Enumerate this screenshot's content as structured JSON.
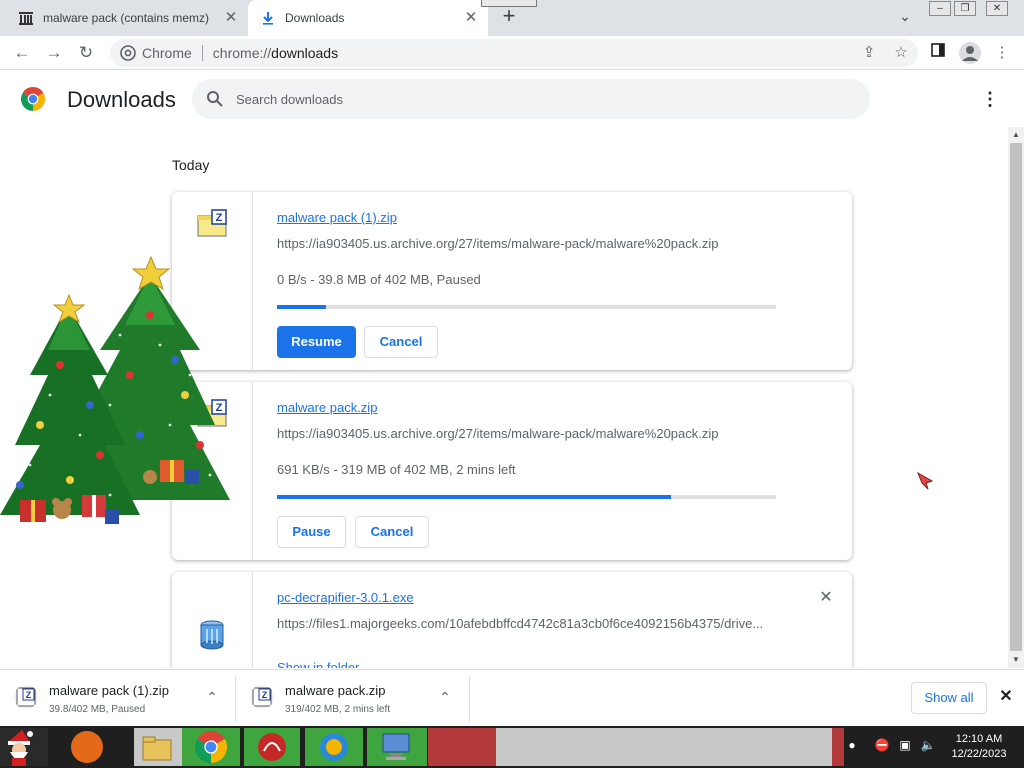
{
  "tabs": [
    {
      "title": "malware pack (contains memz) :",
      "active": false
    },
    {
      "title": "Downloads",
      "active": true
    }
  ],
  "toolbar": {
    "omnibox_label": "Chrome",
    "url_scheme": "chrome://",
    "url_host": "downloads"
  },
  "header": {
    "title": "Downloads",
    "search_placeholder": "Search downloads"
  },
  "list": {
    "date_label": "Today",
    "items": [
      {
        "name": "malware pack (1).zip",
        "url": "https://ia903405.us.archive.org/27/items/malware-pack/malware%20pack.zip",
        "status": "0 B/s - 39.8 MB of 402 MB, Paused",
        "progress": 0.099,
        "primary_button": "Resume",
        "secondary_button": "Cancel"
      },
      {
        "name": "malware pack.zip",
        "url": "https://ia903405.us.archive.org/27/items/malware-pack/malware%20pack.zip",
        "status": "691 KB/s - 319 MB of 402 MB, 2 mins left",
        "progress": 0.79,
        "primary_button": "Pause",
        "secondary_button": "Cancel"
      },
      {
        "name": "pc-decrapifier-3.0.1.exe",
        "url": "https://files1.majorgeeks.com/10afebdbffcd4742c81a3cb0f6ce4092156b4375/drive...",
        "link": "Show in folder",
        "remove_icon": "close-icon"
      }
    ]
  },
  "shelf": {
    "items": [
      {
        "name": "malware pack (1).zip",
        "status": "39.8/402 MB, Paused"
      },
      {
        "name": "malware pack.zip",
        "status": "319/402 MB, 2 mins left"
      }
    ],
    "show_all": "Show all"
  },
  "taskbar": {
    "time": "12:10 AM",
    "date": "12/22/2023"
  },
  "colors": {
    "accent": "#1a73e8",
    "tabstrip": "#dee1e6"
  }
}
